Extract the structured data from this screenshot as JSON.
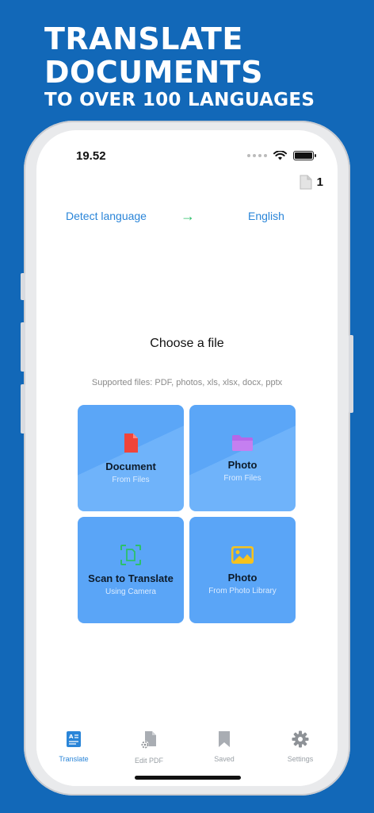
{
  "headline": {
    "line1": "TRANSLATE",
    "line2": "DOCUMENTS",
    "line3": "TO OVER 100 LANGUAGES"
  },
  "status": {
    "time": "19.52"
  },
  "doc_count": "1",
  "languages": {
    "from": "Detect language",
    "to": "English",
    "arrow": "→"
  },
  "main": {
    "heading": "Choose a file",
    "supported": "Supported files: PDF, photos, xls, xlsx, docx, pptx"
  },
  "cards": [
    {
      "title": "Document",
      "sub": "From Files",
      "icon": "document-icon"
    },
    {
      "title": "Photo",
      "sub": "From Files",
      "icon": "folder-icon"
    },
    {
      "title": "Scan to Translate",
      "sub": "Using Camera",
      "icon": "scan-icon"
    },
    {
      "title": "Photo",
      "sub": "From Photo Library",
      "icon": "image-icon"
    }
  ],
  "tabs": [
    {
      "label": "Translate",
      "icon": "translate-icon",
      "active": true
    },
    {
      "label": "Edit PDF",
      "icon": "edit-pdf-icon",
      "active": false
    },
    {
      "label": "Saved",
      "icon": "bookmark-icon",
      "active": false
    },
    {
      "label": "Settings",
      "icon": "gear-icon",
      "active": false
    }
  ],
  "colors": {
    "background": "#1268B8",
    "accent": "#2a85d8",
    "card": "#5aa5f7",
    "arrow": "#2cc06a"
  }
}
